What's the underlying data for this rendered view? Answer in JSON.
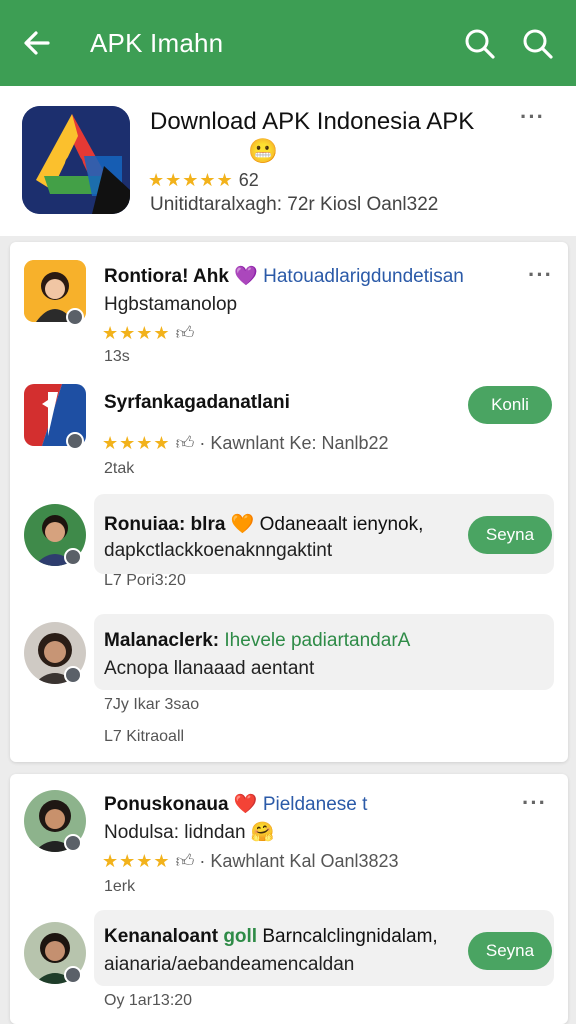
{
  "appbar": {
    "title": "APK Imahn"
  },
  "header": {
    "title": "Download APK Indonesia APK",
    "emoji": "😬",
    "stars": "★★★★★",
    "rating_count": "62",
    "meta": "Unitidtaralxagh: 72r Kiosl Oanl322"
  },
  "feed": {
    "card1": [
      {
        "name": "Rontiora! Ahk",
        "emoji": "💜",
        "accent": "Hatouadlarigdundetisan",
        "sub": "Hgbstamanolop",
        "stars": "★★★★",
        "meta": "",
        "time": "13s"
      },
      {
        "name": "Syrfankagadanatlani",
        "emoji": "",
        "accent": "",
        "stars": "★★★★",
        "meta": "· Kawnlant Ke: Nanlb22",
        "time": "2tak",
        "button": "Konli"
      },
      {
        "name": "Ronuiaa: blra",
        "emoji": "🧡",
        "accent": "Odaneaalt ienynok,",
        "sub": "dapkctlackkoenaknngaktint",
        "time": "L7 Pori3:20",
        "button": "Seyna"
      },
      {
        "name": "Malanaclerk:",
        "emoji": "",
        "accent": "Ihevele padiartandarA",
        "sub": "Acnopa llanaaad aentant",
        "time": "7Jy Ikar 3sao",
        "time2": "L7 Kitraoall"
      }
    ],
    "card2": [
      {
        "name": "Ponuskonaua",
        "emoji": "❤️",
        "accent": "Pieldanese t",
        "sub": "Nodulsa: lidndan",
        "sub_emoji": "🤗",
        "stars": "★★★★",
        "meta": "· Kawhlant Kal Oanl3823",
        "time": "1erk"
      },
      {
        "name": "Kenanaloant",
        "accent_green": "goll",
        "accent": "Barncalclingnidalam,",
        "sub": "aianaria/aebandeamencaldan",
        "time": "Oy 1ar13:20",
        "button": "Seyna"
      }
    ]
  },
  "colors": {
    "appbar": "#3d9e54",
    "button": "#4aa462",
    "star": "#f2b21b",
    "accent_blue": "#2b5aa8"
  },
  "icons": [
    "back-arrow-icon",
    "search-icon",
    "more-vert-icon",
    "thumb-up-icon",
    "verified-badge-icon"
  ]
}
